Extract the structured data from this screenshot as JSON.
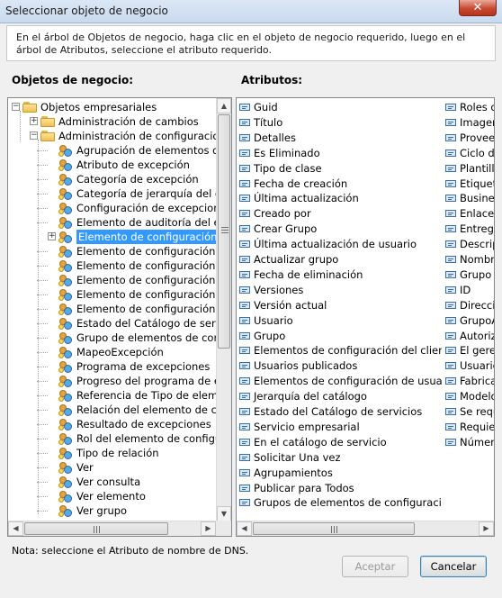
{
  "window": {
    "title": "Seleccionar objeto de negocio",
    "close_glyph": "✕",
    "instruction": "En el árbol de Objetos de negocio, haga clic en el objeto de negocio requerido, luego en el árbol de Atributos, seleccione el atributo requerido."
  },
  "labels": {
    "objects": "Objetos de negocio:",
    "attributes": "Atributos:"
  },
  "tree": {
    "root": "Objetos empresariales",
    "groups": [
      "Administración de cambios",
      "Administración de configuraciones"
    ],
    "items": [
      "Agrupación de elementos de co",
      "Atributo de excepción",
      "Categoría de excepción",
      "Categoría de jerarquía del catá",
      "Configuración de excepciones",
      "Elemento de auditoría del eleme",
      "Elemento de configuración",
      "Elemento de configuración de e",
      "Elemento de configuración de p",
      "Elemento de configuración de u",
      "Elemento de configuración del c",
      "Elemento de configuración publ",
      "Estado del Catálogo de servicio",
      "Grupo de elementos de configu",
      "MapeoExcepción",
      "Programa de excepciones",
      "Progreso del programa de exce",
      "Referencia de Tipo de elemento",
      "Relación del elemento de config",
      "Resultado de excepciones",
      "Rol del elemento de configuraci",
      "Tipo de relación",
      "Ver",
      "Ver consulta",
      "Ver elemento",
      "Ver grupo"
    ],
    "selected_index": 6
  },
  "attributes": {
    "col1": [
      "Guid",
      "Título",
      "Detalles",
      "Es Eliminado",
      "Tipo de clase",
      "Fecha de creación",
      "Última actualización",
      "Creado por",
      "Crear Grupo",
      "Última actualización de usuario",
      "Actualizar grupo",
      "Fecha de eliminación",
      "Versiones",
      "Versión actual",
      "Usuario",
      "Grupo",
      "Elementos de configuración del cliente",
      "Usuarios publicados",
      "Elementos de configuración de usuario",
      "Jerarquía del catálogo",
      "Estado del Catálogo de servicios",
      "Servicio empresarial",
      "En el catálogo de servicio",
      "Solicitar Una vez",
      "Agrupamientos",
      "Publicar para Todos",
      "Grupos de elementos de configuración"
    ],
    "col2": [
      "Roles de",
      "Imagen",
      "Proveed",
      "Ciclo de",
      "Plantilla",
      "Etiqueta",
      "Busines",
      "Enlaces",
      "Entrega",
      "Descrip",
      "Nombre",
      "Grupo d",
      "ID",
      "Direcció",
      "GrupoA",
      "Autoriza",
      "El gerer",
      "Usuario",
      "Fabrican",
      "Modelo",
      "Se requ",
      "Requier",
      "Número"
    ]
  },
  "footer": {
    "note": "Nota: seleccione el Atributo de nombre de DNS.",
    "accept": "Aceptar",
    "cancel": "Cancelar"
  }
}
